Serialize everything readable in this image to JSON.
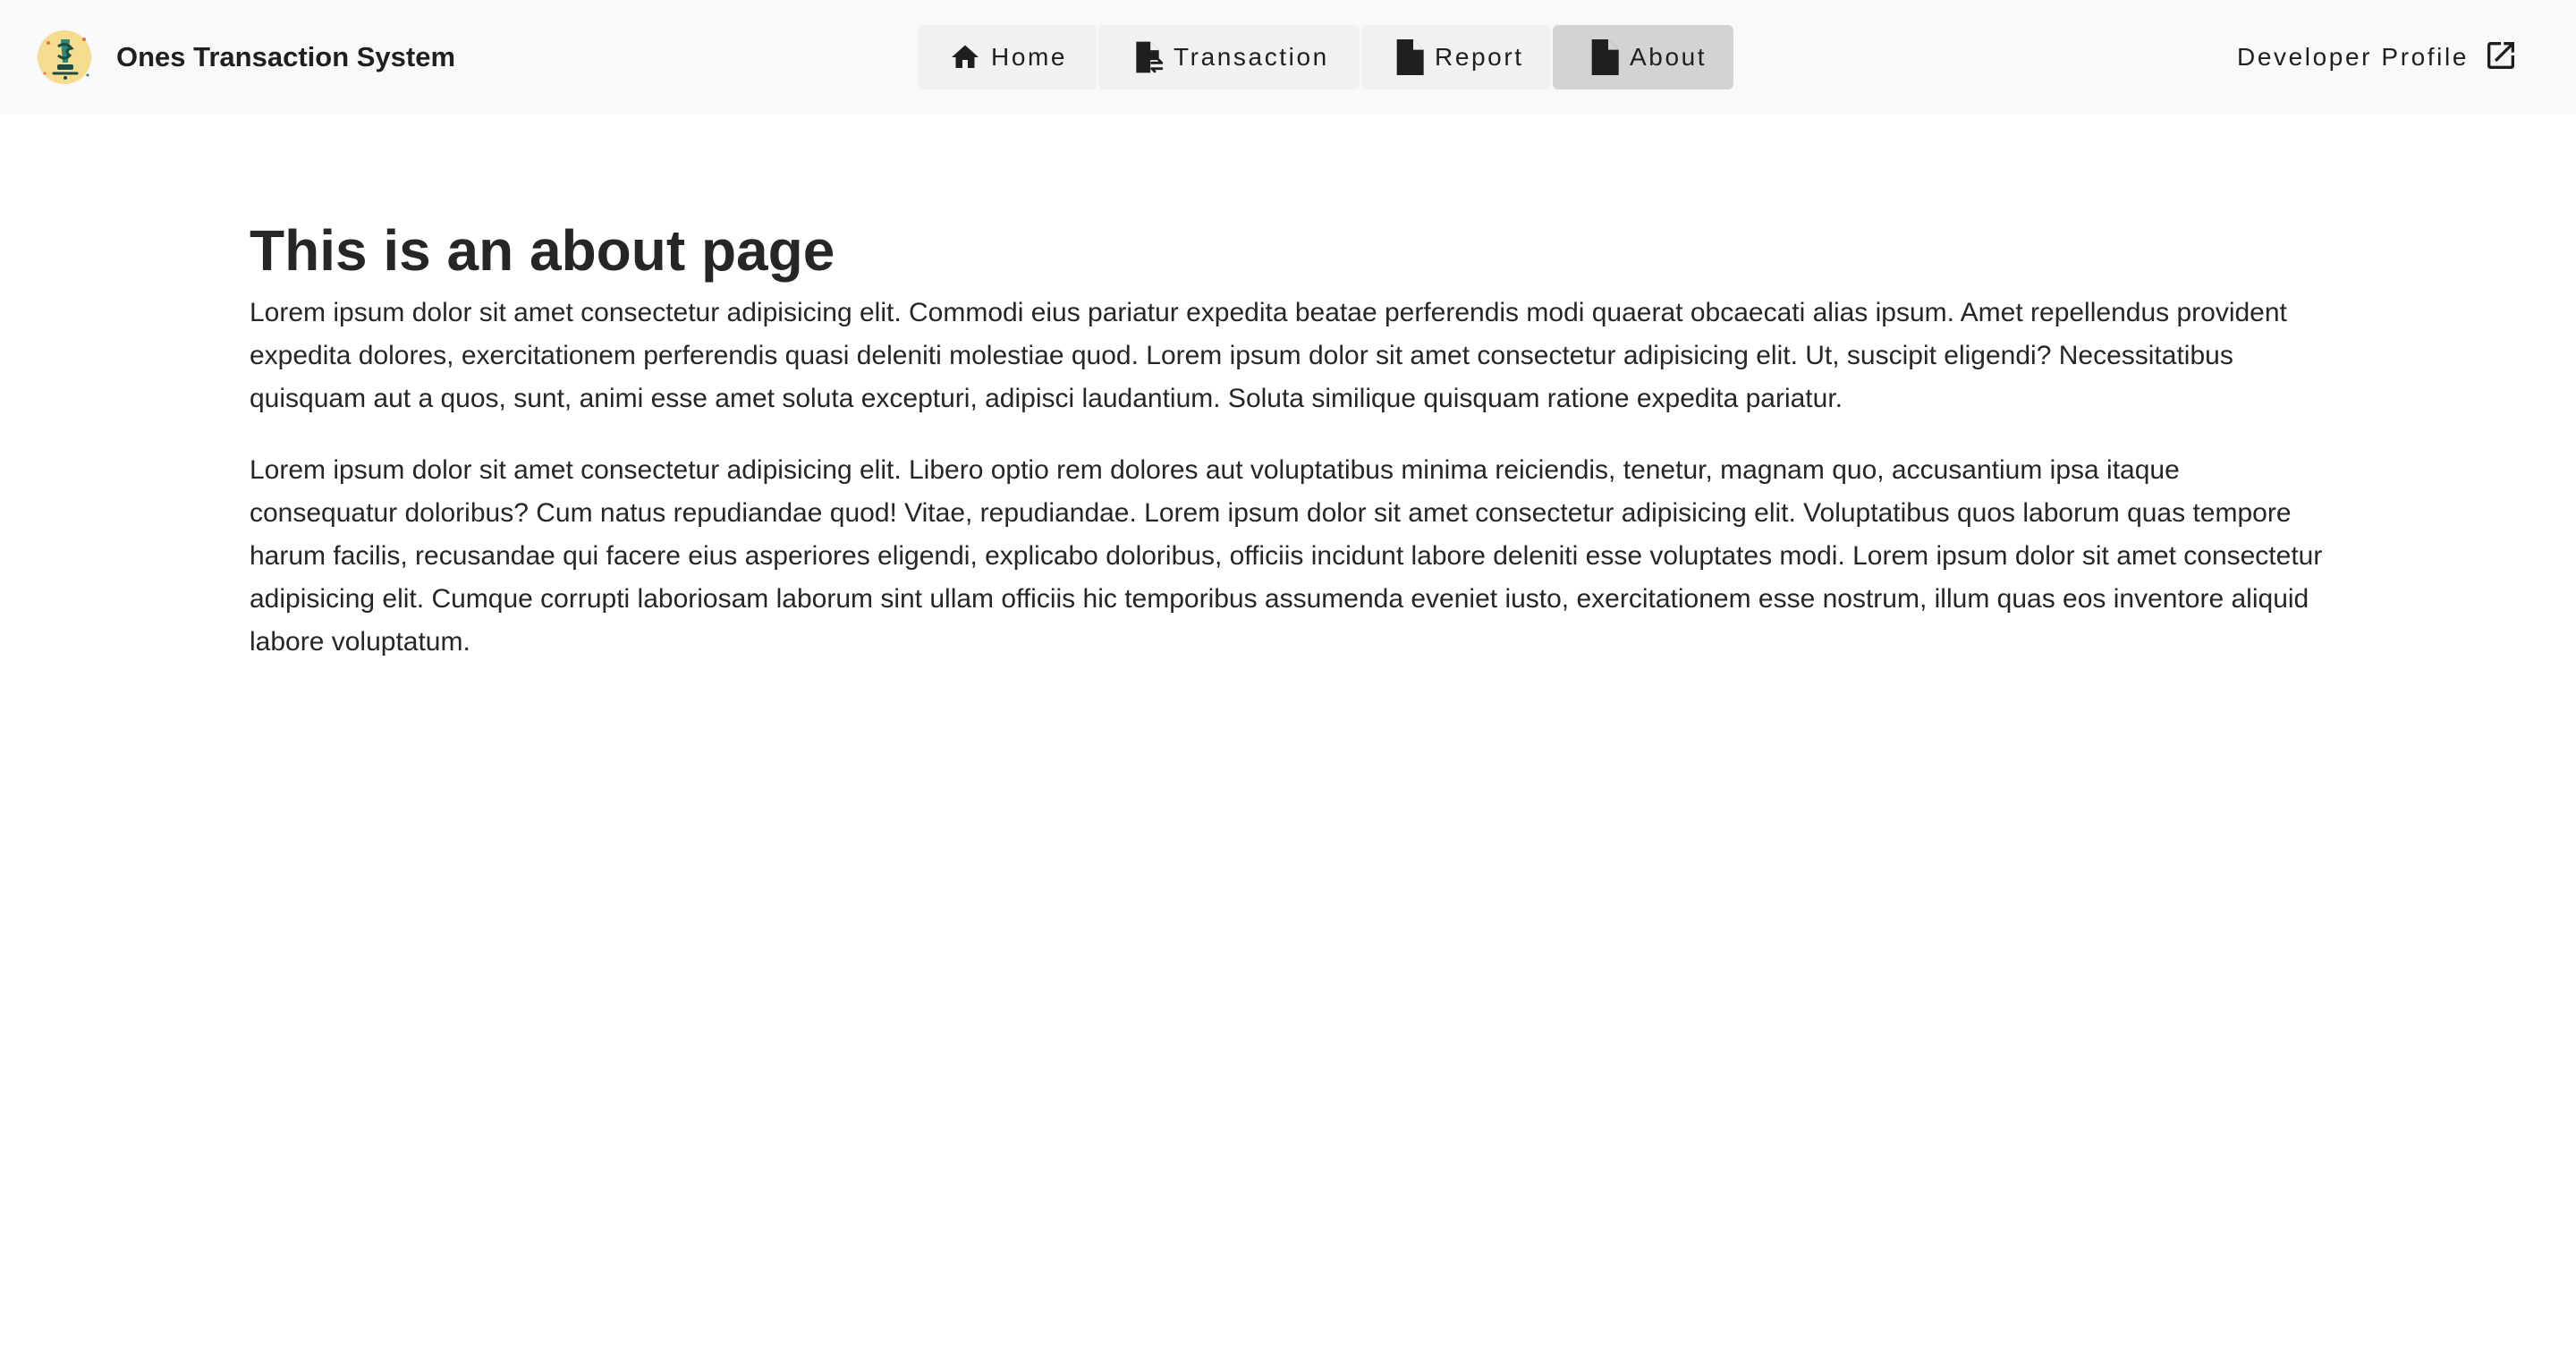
{
  "app": {
    "title": "Ones Transaction System",
    "logo_icon": "dollar-pen-logo-icon"
  },
  "nav": {
    "items": [
      {
        "label": "Home",
        "icon": "home-icon",
        "active": false
      },
      {
        "label": "Transaction",
        "icon": "file-transfer-icon",
        "active": false
      },
      {
        "label": "Report",
        "icon": "file-icon",
        "active": false
      },
      {
        "label": "About",
        "icon": "file-icon",
        "active": true
      }
    ]
  },
  "developer": {
    "label": "Developer Profile",
    "icon": "open-in-new-icon"
  },
  "page": {
    "title": "This is an about page",
    "paragraphs": [
      "Lorem ipsum dolor sit amet consectetur adipisicing elit. Commodi eius pariatur expedita beatae perferendis modi quaerat obcaecati alias ipsum. Amet repellendus provident expedita dolores, exercitationem perferendis quasi deleniti molestiae quod. Lorem ipsum dolor sit amet consectetur adipisicing elit. Ut, suscipit eligendi? Necessitatibus quisquam aut a quos, sunt, animi esse amet soluta excepturi, adipisci laudantium. Soluta similique quisquam ratione expedita pariatur.",
      "Lorem ipsum dolor sit amet consectetur adipisicing elit. Libero optio rem dolores aut voluptatibus minima reiciendis, tenetur, magnam quo, accusantium ipsa itaque consequatur doloribus? Cum natus repudiandae quod! Vitae, repudiandae. Lorem ipsum dolor sit amet consectetur adipisicing elit. Voluptatibus quos laborum quas tempore harum facilis, recusandae qui facere eius asperiores eligendi, explicabo doloribus, officiis incidunt labore deleniti esse voluptates modi. Lorem ipsum dolor sit amet consectetur adipisicing elit. Cumque corrupti laboriosam laborum sint ullam officiis hic temporibus assumenda eveniet iusto, exercitationem esse nostrum, illum quas eos inventore aliquid labore voluptatum."
    ]
  },
  "colors": {
    "navbar_bg": "#f9f9f9",
    "nav_item_bg": "#f1f1f1",
    "nav_active_bg": "#d3d3d3",
    "text": "#262626",
    "logo_bg": "#f5dc8f",
    "logo_accent": "#2a8a7a"
  }
}
